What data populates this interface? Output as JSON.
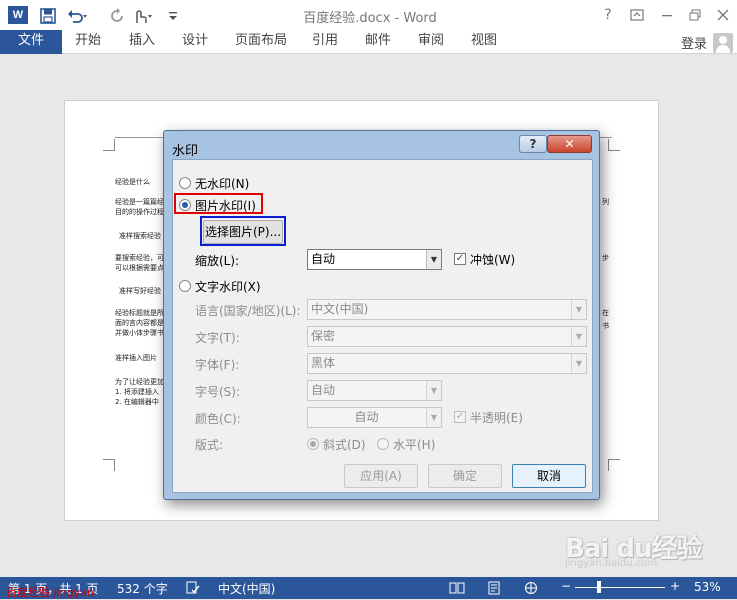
{
  "app": {
    "logo": "W",
    "doc_title": "百度经验.docx - Word",
    "help": "?",
    "login": "登录"
  },
  "ribbon_tabs": [
    "文件",
    "开始",
    "插入",
    "设计",
    "页面布局",
    "引用",
    "邮件",
    "审阅",
    "视图"
  ],
  "document": {
    "lines": [
      "经验是什么",
      "经验是一篇篇经",
      "目的的操作过程",
      "准样搜索经验",
      "要搜索经验，可",
      "可以根据需要点",
      "准样写好经验",
      "经验标题就是所",
      "面的言内容都是",
      "并做小体步骤书",
      "准样插入图片",
      "为了让经验更加",
      "1. 将添建插入",
      "2. 在编辑器中",
      "列",
      "步",
      "在",
      "书"
    ]
  },
  "dialog": {
    "title": "水印",
    "help_button": "?",
    "close_button": "✕",
    "no_watermark": "无水印(N)",
    "picture_watermark": "图片水印(I)",
    "select_picture": "选择图片(P)...",
    "scale_label": "缩放(L):",
    "scale_value": "自动",
    "washout_label": "冲蚀(W)",
    "washout_checked": true,
    "text_watermark": "文字水印(X)",
    "language_label": "语言(国家/地区)(L):",
    "language_value": "中文(中国)",
    "text_label": "文字(T):",
    "text_value": "保密",
    "font_label": "字体(F):",
    "font_value": "黑体",
    "size_label": "字号(S):",
    "size_value": "自动",
    "color_label": "颜色(C):",
    "color_value": "自动",
    "semitransparent_label": "半透明(E)",
    "semitransparent_checked": true,
    "layout_label": "版式:",
    "diagonal_label": "斜式(D)",
    "horizontal_label": "水平(H)",
    "apply_button": "应用(A)",
    "ok_button": "确定",
    "cancel_button": "取消",
    "selected_mode": "picture"
  },
  "status_bar": {
    "page": "第 1 页，共 1 页",
    "words": "532 个字",
    "language": "中文(中国)",
    "zoom_percent": "53%",
    "zoom_level": 0.53,
    "zoom_minus": "−",
    "zoom_plus": "+"
  },
  "overlays": {
    "brand_logo": "Bai du经验",
    "brand_url": "jingyan.baidu.com",
    "caption": "百度经验 jingyan"
  },
  "colors": {
    "brand": "#2b579a",
    "highlight_red": "#e00000",
    "highlight_blue": "#0a1fd0"
  }
}
